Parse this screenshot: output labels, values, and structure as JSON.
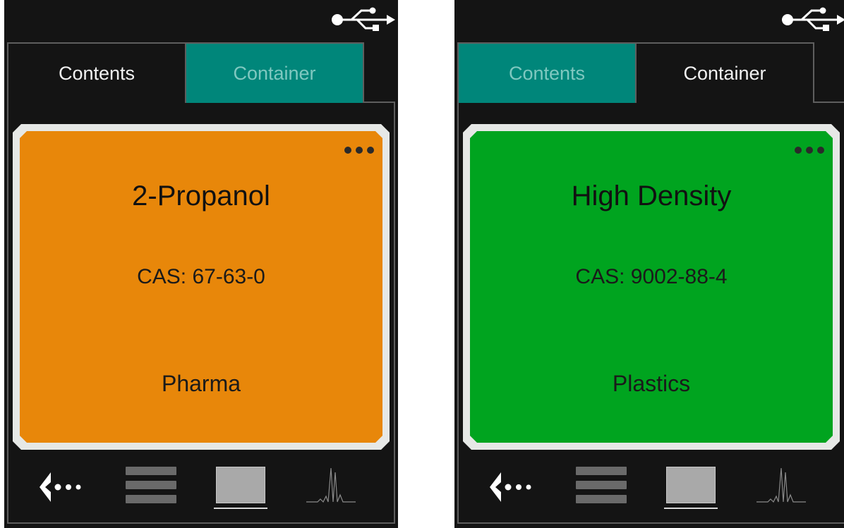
{
  "screens": [
    {
      "tabs": [
        "Contents",
        "Container"
      ],
      "active_tab": 0,
      "card": {
        "title": "2-Propanol",
        "cas": "CAS: 67-63-0",
        "category": "Pharma",
        "color": "#e8870a"
      },
      "icons": [
        "usb-icon",
        "more-icon",
        "back-icon",
        "list-view-icon",
        "card-view-icon",
        "spectrum-icon"
      ]
    },
    {
      "tabs": [
        "Contents",
        "Container"
      ],
      "active_tab": 1,
      "card": {
        "title": "High Density",
        "cas": "CAS: 9002-88-4",
        "category": "Plastics",
        "color": "#00a41f"
      },
      "icons": [
        "usb-icon",
        "more-icon",
        "back-icon",
        "list-view-icon",
        "card-view-icon",
        "spectrum-icon"
      ]
    }
  ],
  "colors": {
    "background": "#141414",
    "inactive_tab": "#00867a",
    "inactive_tab_text": "#7fc8c0",
    "frame": "#5e5e5e"
  }
}
